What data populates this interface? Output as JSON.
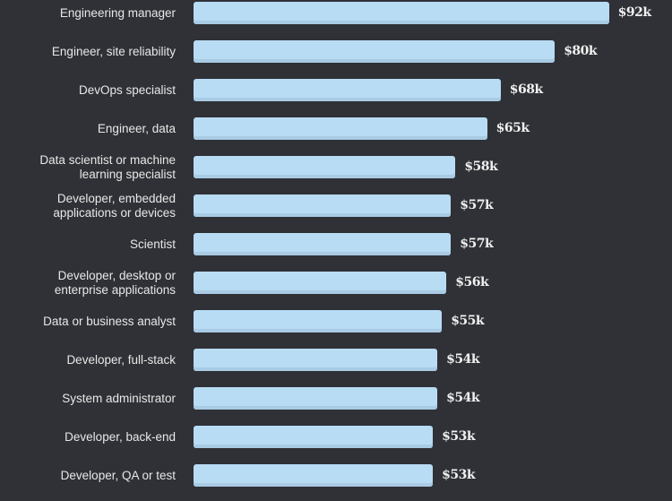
{
  "chart_data": {
    "type": "bar",
    "orientation": "horizontal",
    "title": "",
    "xlabel": "",
    "ylabel": "",
    "value_prefix": "$",
    "value_suffix": "k",
    "xlim": [
      0,
      100
    ],
    "grid": false,
    "legend": "none",
    "bar_color": "#b9dcf5",
    "background_color": "#2f3136",
    "categories": [
      "Engineering manager",
      "Engineer, site reliability",
      "DevOps specialist",
      "Engineer, data",
      "Data scientist or machine\nlearning specialist",
      "Developer, embedded\napplications or devices",
      "Scientist",
      "Developer, desktop or\nenterprise applications",
      "Data or business analyst",
      "Developer, full-stack",
      "System administrator",
      "Developer, back-end",
      "Developer, QA or test"
    ],
    "values": [
      92,
      80,
      68,
      65,
      58,
      57,
      57,
      56,
      55,
      54,
      54,
      53,
      53
    ],
    "value_labels": [
      "$92k",
      "$80k",
      "$68k",
      "$65k",
      "$58k",
      "$57k",
      "$57k",
      "$56k",
      "$55k",
      "$54k",
      "$54k",
      "$53k",
      "$53k"
    ]
  }
}
